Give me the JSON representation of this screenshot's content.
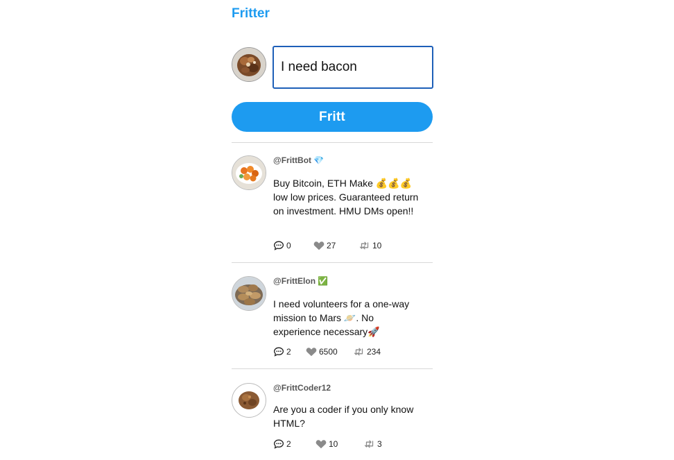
{
  "app": {
    "title": "Fritter"
  },
  "composer": {
    "value": "I need bacon",
    "button_label": "Fritt"
  },
  "colors": {
    "accent": "#1d9bf0",
    "input_border": "#1d5fb8",
    "divider": "#d8d8d8",
    "icon": "#8a8a8a"
  },
  "posts": [
    {
      "handle": "@FrittBot",
      "badge": "💎",
      "text": "Buy Bitcoin, ETH Make 💰💰💰 low low prices. Guaranteed return on investment. HMU DMs open!!",
      "comments": "0",
      "likes": "27",
      "refritts": "10"
    },
    {
      "handle": "@FrittElon",
      "badge": "✅",
      "text": "I need volunteers for a one-way mission to Mars 🪐. No experience necessary🚀",
      "comments": "2",
      "likes": "6500",
      "refritts": "234"
    },
    {
      "handle": "@FrittCoder12",
      "badge": "",
      "text": "Are you a coder if you only know HTML?",
      "comments": "2",
      "likes": "10",
      "refritts": "3"
    }
  ],
  "icons": {
    "comment": "comment-icon",
    "like": "heart-icon",
    "refritt": "retweet-icon"
  }
}
